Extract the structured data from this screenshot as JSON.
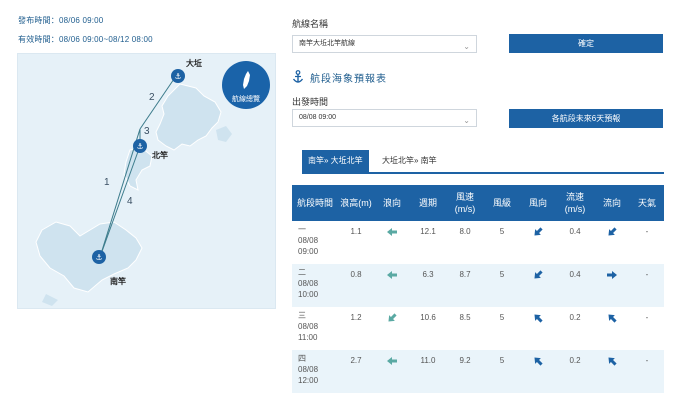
{
  "meta": {
    "published": "發布時間：08/06 09:00",
    "valid": "有效時間：08/06 09:00~08/12 08:00"
  },
  "map": {
    "overview_label": "航線總覽",
    "labels": {
      "dagan": "大坵",
      "beigan": "北竿",
      "nangan": "南竿"
    },
    "routes": [
      "1",
      "2",
      "3",
      "4"
    ]
  },
  "form": {
    "route_label": "航線名稱",
    "route_value": "南竿大坵北竿航線",
    "confirm": "確定",
    "section_title": "航段海象預報表",
    "depart_label": "出發時間",
    "depart_value": "08/08 09:00",
    "six_day_btn": "各航段未來6天預報"
  },
  "tabs": [
    {
      "label": "南竿» 大坵北竿"
    },
    {
      "label": "大坵北竿» 南竿"
    }
  ],
  "table": {
    "headers": [
      "航段時間",
      "浪高(m)",
      "浪向",
      "週期",
      "風速(m/s)",
      "風級",
      "風向",
      "流速(m/s)",
      "流向",
      "天氣"
    ],
    "rows": [
      {
        "seg": "一",
        "date": "08/08",
        "time": "09:00",
        "wave": "1.1",
        "period": "12.1",
        "wind": "8.0",
        "level": "5",
        "current": "0.4",
        "weather": "-",
        "wave_dir": "left",
        "wind_dir": "down-left",
        "cur_dir": "down-left"
      },
      {
        "seg": "二",
        "date": "08/08",
        "time": "10:00",
        "wave": "0.8",
        "period": "6.3",
        "wind": "8.7",
        "level": "5",
        "current": "0.4",
        "weather": "-",
        "wave_dir": "left",
        "wind_dir": "down-left",
        "cur_dir": "right"
      },
      {
        "seg": "三",
        "date": "08/08",
        "time": "11:00",
        "wave": "1.2",
        "period": "10.6",
        "wind": "8.5",
        "level": "5",
        "current": "0.2",
        "weather": "-",
        "wave_dir": "down-left",
        "wind_dir": "up-left",
        "cur_dir": "up-left"
      },
      {
        "seg": "四",
        "date": "08/08",
        "time": "12:00",
        "wave": "2.7",
        "period": "11.0",
        "wind": "9.2",
        "level": "5",
        "current": "0.2",
        "weather": "-",
        "wave_dir": "left",
        "wind_dir": "up-left",
        "cur_dir": "up-left"
      }
    ]
  },
  "colors": {
    "accent": "#1d62a4",
    "wave_arrow": "#5aa9a3",
    "dir_arrow": "#1d62a4"
  }
}
